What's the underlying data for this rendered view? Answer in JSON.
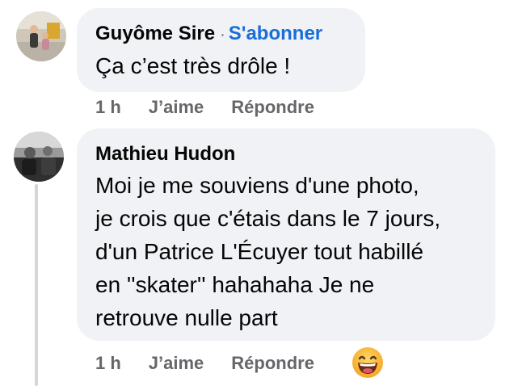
{
  "comments": [
    {
      "author": "Guyôme Sire",
      "separator": "·",
      "follow_label": "S'abonner",
      "text": "Ça c’est très drôle !",
      "time": "1 h",
      "like_label": "J’aime",
      "reply_label": "Répondre"
    },
    {
      "author": "Mathieu Hudon",
      "text": "Moi je me souviens d'une photo,\nje crois que c'étais dans le 7 jours,\nd'un Patrice L'Écuyer tout habillé\nen ''skater'' hahahaha Je ne\nretrouve nulle part",
      "time": "1 h",
      "like_label": "J’aime",
      "reply_label": "Répondre",
      "reaction": "grinning-sweat-emoji"
    }
  ],
  "colors": {
    "bubble_bg": "#f0f2f5",
    "link": "#1a6ed8",
    "secondary_text": "#65676b"
  }
}
